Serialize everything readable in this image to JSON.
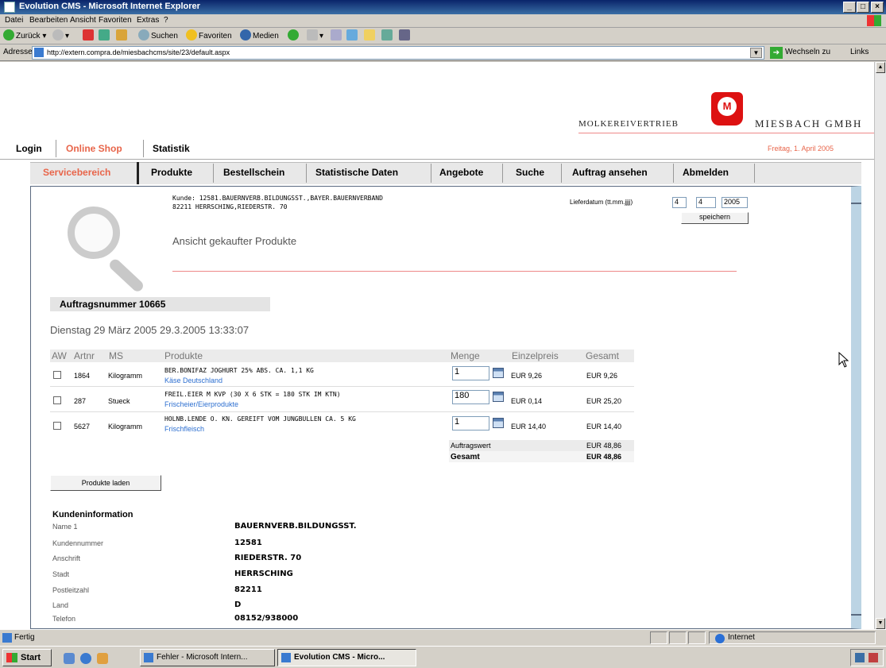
{
  "window": {
    "title": "Evolution CMS - Microsoft Internet Explorer"
  },
  "menu": [
    "Datei",
    "Bearbeiten",
    "Ansicht",
    "Favoriten",
    "Extras",
    "?"
  ],
  "toolbar": {
    "back": "Zurück",
    "search": "Suchen",
    "favorites": "Favoriten",
    "media": "Medien"
  },
  "address": {
    "label": "Adresse",
    "url": "http://extern.compra.de/miesbachcms/site/23/default.aspx",
    "go": "Wechseln zu",
    "links": "Links"
  },
  "logo": {
    "left": "MOLKEREIVERTRIEB",
    "mark": "M",
    "right": "MIESBACH GMBH"
  },
  "topnav": {
    "login": "Login",
    "shop": "Online Shop",
    "stats": "Statistik",
    "date": "Freitag, 1. April 2005"
  },
  "tabs": [
    "Servicebereich",
    "Produkte",
    "Bestellschein",
    "Statistische Daten",
    "Angebote",
    "Suche",
    "Auftrag ansehen",
    "Abmelden"
  ],
  "customer": {
    "line1": "Kunde: 12581.BAUERNVERB.BILDUNGSST.,BAYER.BAUERNVERBAND",
    "line2": "82211 HERRSCHING,RIEDERSTR. 70"
  },
  "delivery": {
    "label": "Lieferdatum (tt.mm.jjjj)",
    "day": "4",
    "month": "4",
    "year": "2005",
    "save": "speichern"
  },
  "page_title": "Ansicht gekaufter Produkte",
  "order": {
    "label": "Auftragsnummer 10665",
    "date": "Dienstag 29 März 2005 29.3.2005 13:33:07"
  },
  "table": {
    "headers": {
      "aw": "AW",
      "artnr": "Artnr",
      "ms": "MS",
      "produkte": "Produkte",
      "menge": "Menge",
      "einzelpreis": "Einzelpreis",
      "gesamt": "Gesamt"
    },
    "rows": [
      {
        "artnr": "1864",
        "ms": "Kilogramm",
        "product": "BER.BONIFAZ JOGHURT 25% ABS. CA. 1,1 KG",
        "category": "Käse Deutschland",
        "menge": "1",
        "einzelpreis": "EUR 9,26",
        "gesamt": "EUR 9,26"
      },
      {
        "artnr": "287",
        "ms": "Stueck",
        "product": "FREIL.EIER M KVP (30 X 6 STK = 180 STK IM KTN)",
        "category": "Frischeier/Eierprodukte",
        "menge": "180",
        "einzelpreis": "EUR 0,14",
        "gesamt": "EUR 25,20"
      },
      {
        "artnr": "5627",
        "ms": "Kilogramm",
        "product": "HOLNB.LENDE O. KN. GEREIFT VOM JUNGBULLEN CA. 5 KG",
        "category": "Frischfleisch",
        "menge": "1",
        "einzelpreis": "EUR 14,40",
        "gesamt": "EUR 14,40"
      }
    ],
    "auftragswert_label": "Auftragswert",
    "auftragswert": "EUR 48,86",
    "gesamt_label": "Gesamt",
    "gesamt": "EUR 48,86"
  },
  "load_button": "Produkte laden",
  "kundeninfo": {
    "title": "Kundeninformation",
    "fields": [
      {
        "label": "Name 1",
        "value": "BAUERNVERB.BILDUNGSST."
      },
      {
        "label": "Kundennummer",
        "value": "12581"
      },
      {
        "label": "Anschrift",
        "value": "RIEDERSTR. 70"
      },
      {
        "label": "Stadt",
        "value": "HERRSCHING"
      },
      {
        "label": "Postleitzahl",
        "value": "82211"
      },
      {
        "label": "Land",
        "value": "D"
      },
      {
        "label": "Telefon",
        "value": "08152/938000"
      }
    ]
  },
  "status": {
    "text": "Fertig",
    "zone": "Internet"
  },
  "taskbar": {
    "start": "Start",
    "task1": "Fehler - Microsoft Intern...",
    "task2": "Evolution CMS - Micro..."
  },
  "colors": {
    "accent_red": "#e8654a",
    "link_blue": "#2d6fd0",
    "titlebar": "#0a246a"
  }
}
